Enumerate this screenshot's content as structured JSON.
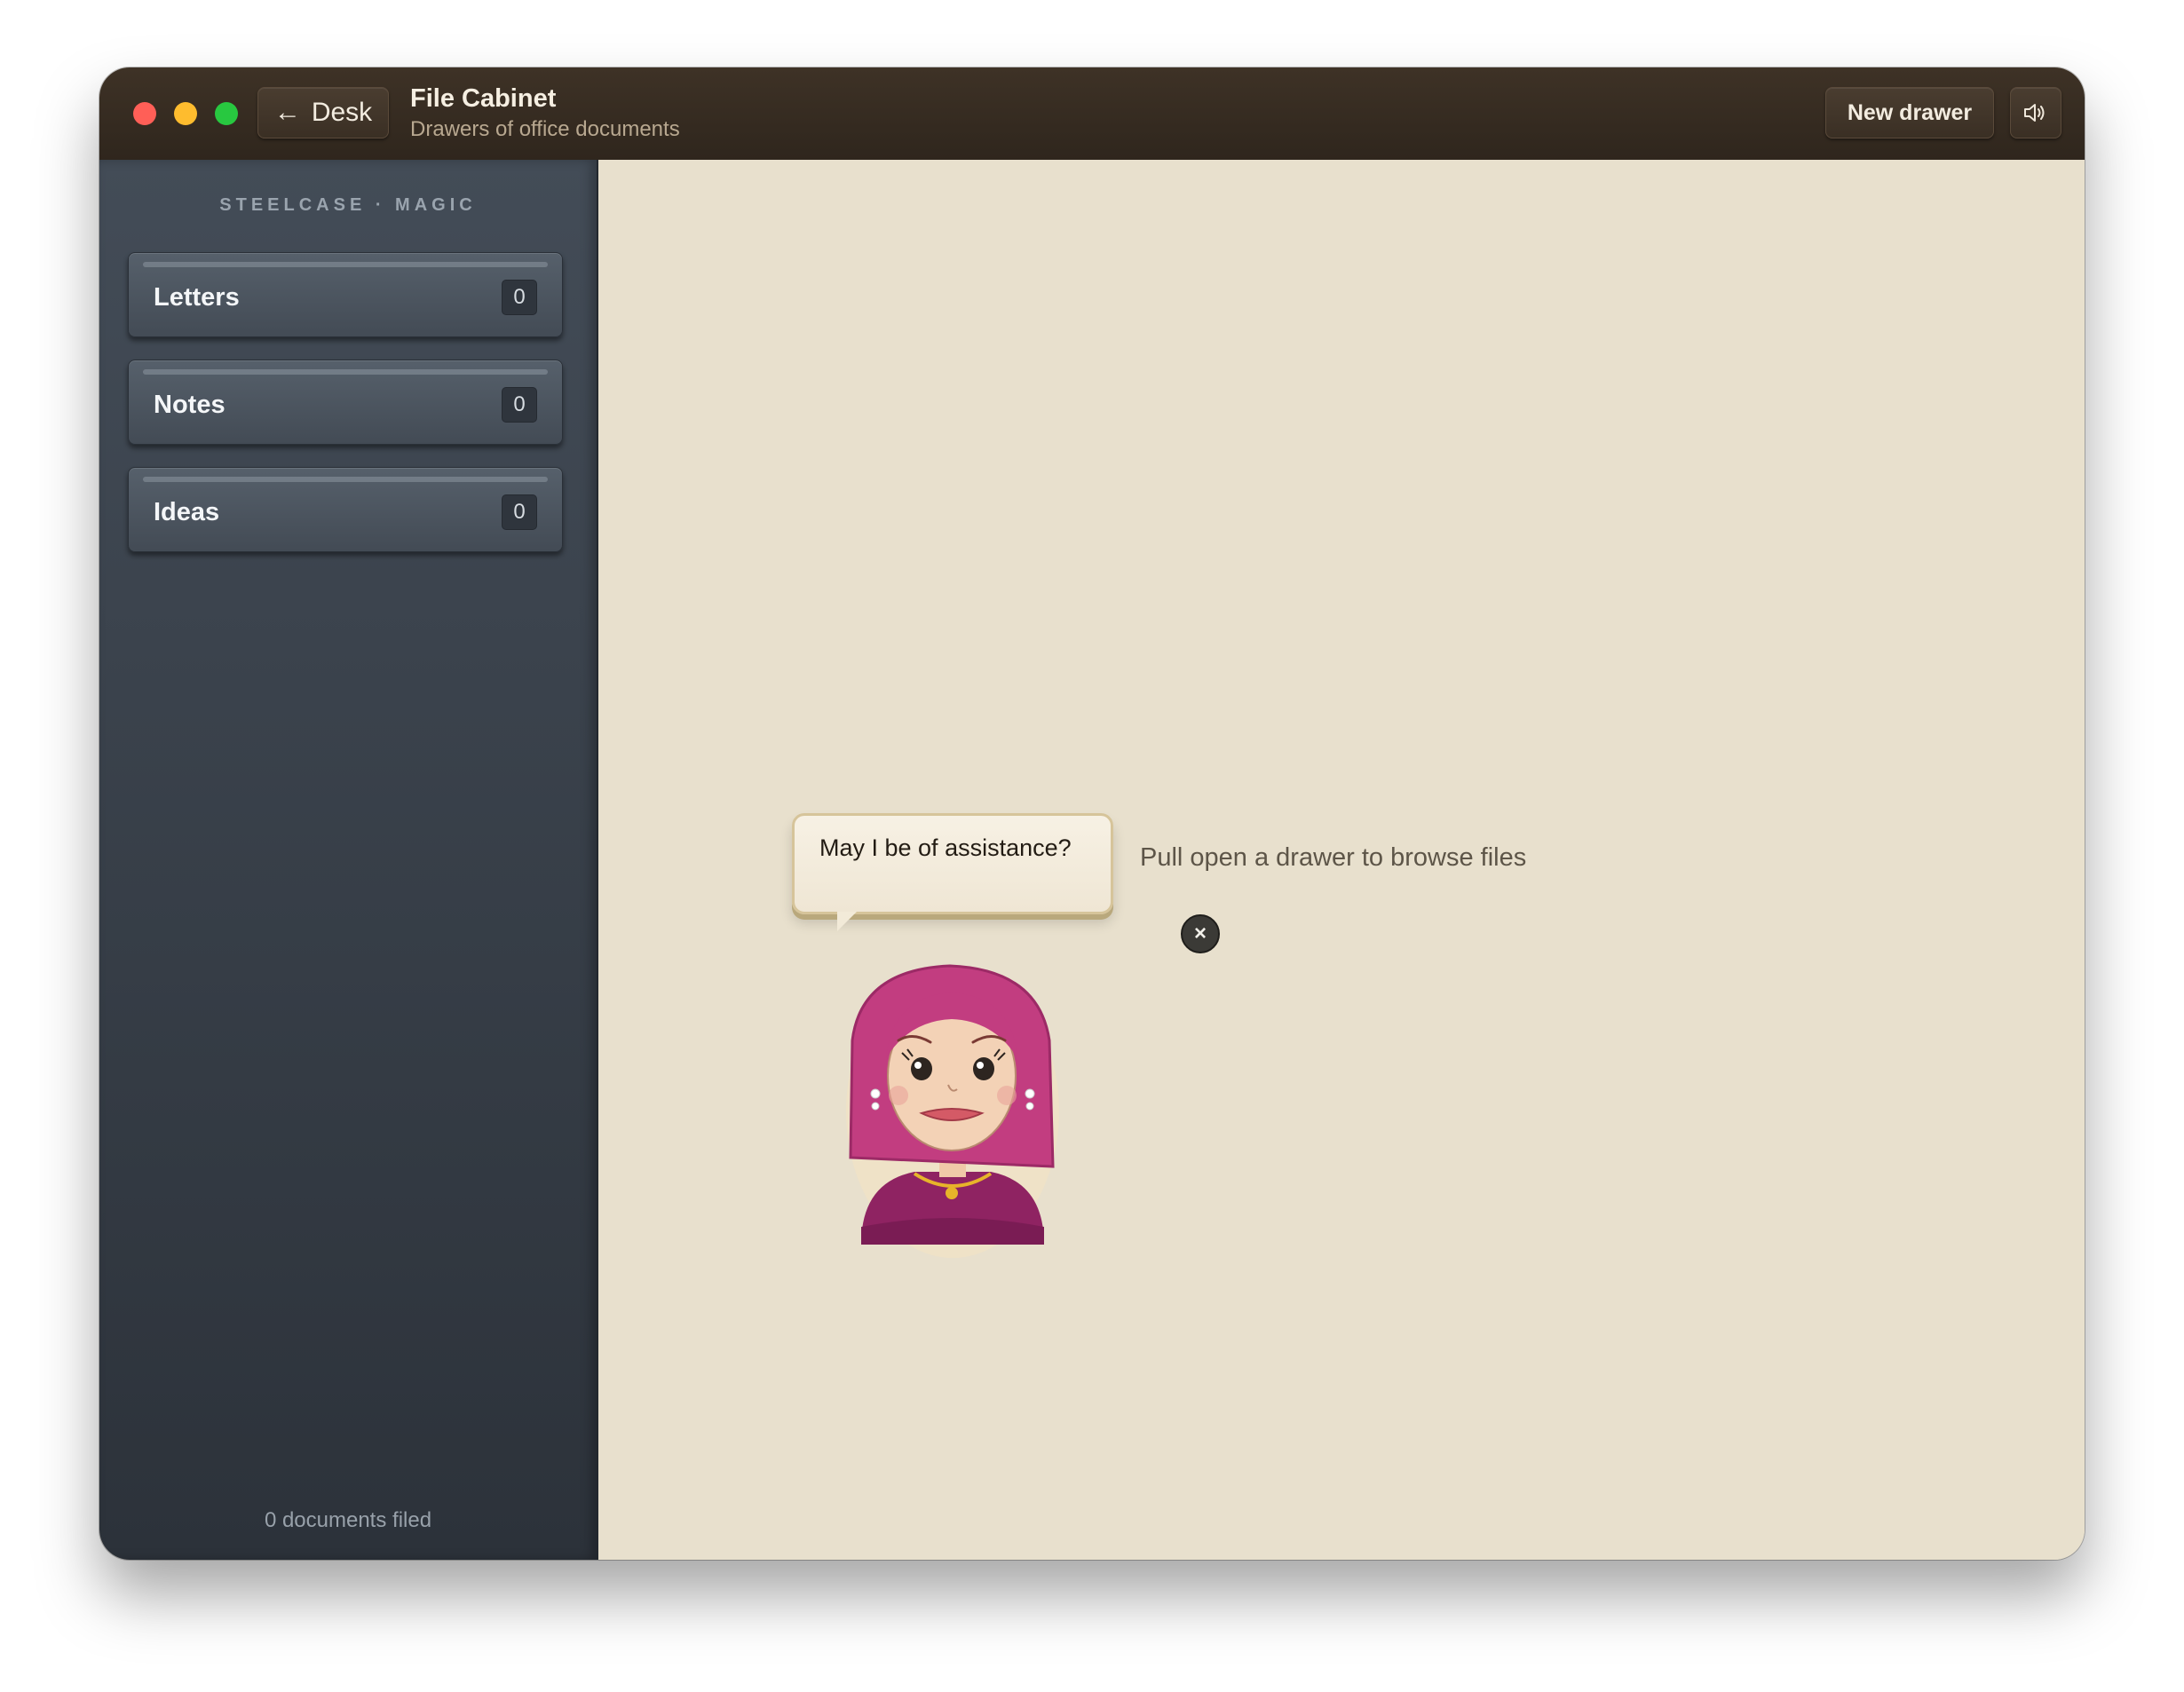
{
  "window": {
    "back_label": "Desk",
    "title": "File Cabinet",
    "subtitle": "Drawers of office documents",
    "new_drawer_label": "New drawer"
  },
  "sidebar": {
    "brand": "STEELCASE · MAGIC",
    "drawers": [
      {
        "label": "Letters",
        "count": "0"
      },
      {
        "label": "Notes",
        "count": "0"
      },
      {
        "label": "Ideas",
        "count": "0"
      }
    ],
    "footer": "0 documents filed"
  },
  "main": {
    "assistant_message": "May I be of assistance?",
    "close_glyph": "×",
    "hint": "Pull open a drawer to browse files"
  },
  "icons": {
    "back": "arrow-left-icon",
    "sound": "speaker-icon",
    "close": "close-icon"
  },
  "colors": {
    "titlebar": "#3a2e23",
    "sidebar": "#3b434d",
    "main_bg": "#e8e0cd",
    "assistant_hood": "#c23d80"
  }
}
